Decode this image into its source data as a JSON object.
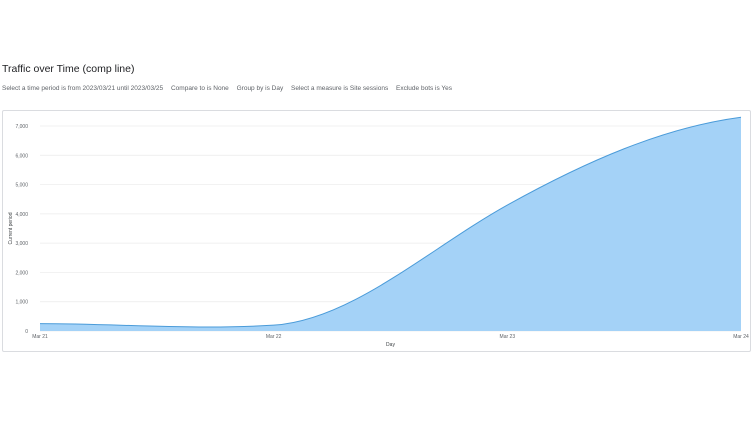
{
  "header": {
    "title": "Traffic over Time (comp line)"
  },
  "filters": [
    "Select a time period is from 2023/03/21 until 2023/03/25",
    "Compare to is None",
    "Group by is Day",
    "Select a measure is Site sessions",
    "Exclude bots is Yes"
  ],
  "chart_data": {
    "type": "area",
    "title": "",
    "xlabel": "Day",
    "ylabel": "Current period",
    "x": [
      "Mar 21",
      "Mar 22",
      "Mar 23",
      "Mar 24"
    ],
    "series": [
      {
        "name": "",
        "values": [
          250,
          200,
          4300,
          7300
        ]
      }
    ],
    "ylim": [
      0,
      7000
    ],
    "yticks": [
      0,
      1000,
      2000,
      3000,
      4000,
      5000,
      6000,
      7000
    ],
    "ytick_labels": [
      "0",
      "1,000",
      "2,000",
      "3,000",
      "4,000",
      "5,000",
      "6,000",
      "7,000"
    ],
    "grid": true,
    "colors": {
      "fill": "#a4d2f7",
      "line": "#4a9bd9",
      "grid": "#ebebeb"
    }
  }
}
